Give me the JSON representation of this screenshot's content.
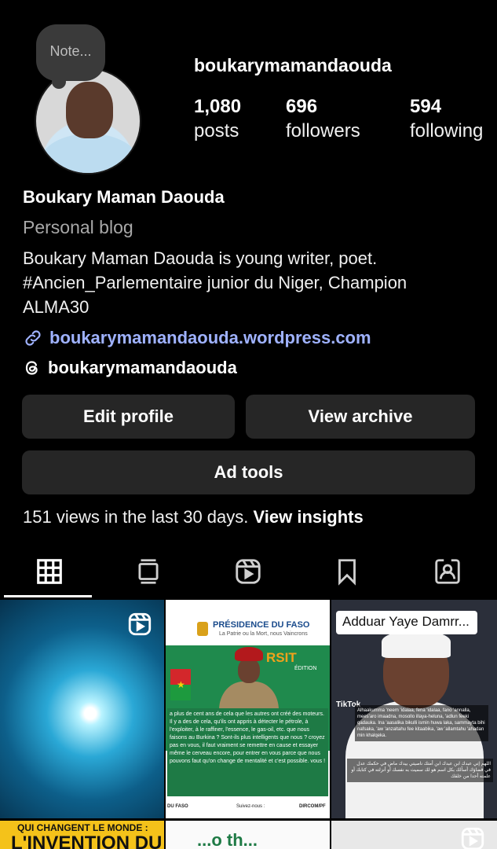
{
  "profile": {
    "note_placeholder": "Note...",
    "username": "boukarymamandaouda",
    "stats": {
      "posts_count": "1,080",
      "posts_label": "posts",
      "followers_count": "696",
      "followers_label": "followers",
      "following_count": "594",
      "following_label": "following"
    },
    "full_name": "Boukary Maman Daouda",
    "category": "Personal blog",
    "bio_line1": "Boukary Maman Daouda is young writer, poet.",
    "bio_line2": "#Ancien_Parlementaire junior du Niger, Champion",
    "bio_line3": "ALMA30",
    "website": "boukarymamandaouda.wordpress.com",
    "threads_handle": "boukarymamandaouda"
  },
  "actions": {
    "edit_profile": "Edit profile",
    "view_archive": "View archive",
    "ad_tools": "Ad tools"
  },
  "insights": {
    "summary": "151 views in the last 30 days.",
    "link": "View insights"
  },
  "tabs": [
    {
      "name": "posts-grid",
      "icon": "grid-icon",
      "active": true
    },
    {
      "name": "feed",
      "icon": "feed-icon",
      "active": false
    },
    {
      "name": "reels",
      "icon": "reels-icon",
      "active": false
    },
    {
      "name": "saved",
      "icon": "bookmark-icon",
      "active": false
    },
    {
      "name": "tagged",
      "icon": "tagged-person-icon",
      "active": false
    }
  ],
  "grid": {
    "tile2": {
      "header": "PRÉSIDENCE DU FASO",
      "header_sub": "La Patrie ou la Mort, nous Vaincrons",
      "title_fragment": "RSIT",
      "edition": "ÉDITION",
      "body": "a plus de cent ans de cela que les autres ont créé des moteurs. Il y a des de cela, qu'ils ont appris à détecter le pétrole, à l'exploiter, à le raffiner, l'essence, le gas-oil, etc. que nous faisons au Burkina ? Sont-ils plus intelligents que nous ? croyez pas en vous, il faut vraiment se remettre en cause et essayer même le cerveau encore, pour entrer en vous parce que nous pouvons faut qu'on change de mentalité et c'est possible. vous !",
      "footer_left": "DU FASO",
      "footer_mid": "Suivez-nous :",
      "footer_right": "DIRCOM/PF"
    },
    "tile3": {
      "caption": "Adduar Yaye Damrr...",
      "tiktok": "TikTok",
      "sub1": "Alhaakumma 'neem 'idalaa, fena 'idalaa, fano 'annalla, mees'aro imaadna, mosollo illaya-heluna, 'adlun feeki qadauka. Ina 'aasalika bikulli ismin huwa laka, sammayta bihi nafsaka, 'aw 'anzaltahu fee kitaabika, 'aw 'allamtahu 'ahadan min khalqeka.",
      "sub2": "اللهم إني عبدك ابن عبدك ابن أمتك ناصيتي بيدك ماض في حكمك عدل في قضاؤك أسألك بكل اسم هو لك سميت به نفسك أو أنزلته في كتابك أو علمته أحدا من خلقك"
    },
    "tile4": {
      "headline1": "QUI CHANGENT LE MONDE :",
      "headline2": "L'INVENTION DU"
    },
    "tile5": {
      "text": "...o th..."
    }
  }
}
